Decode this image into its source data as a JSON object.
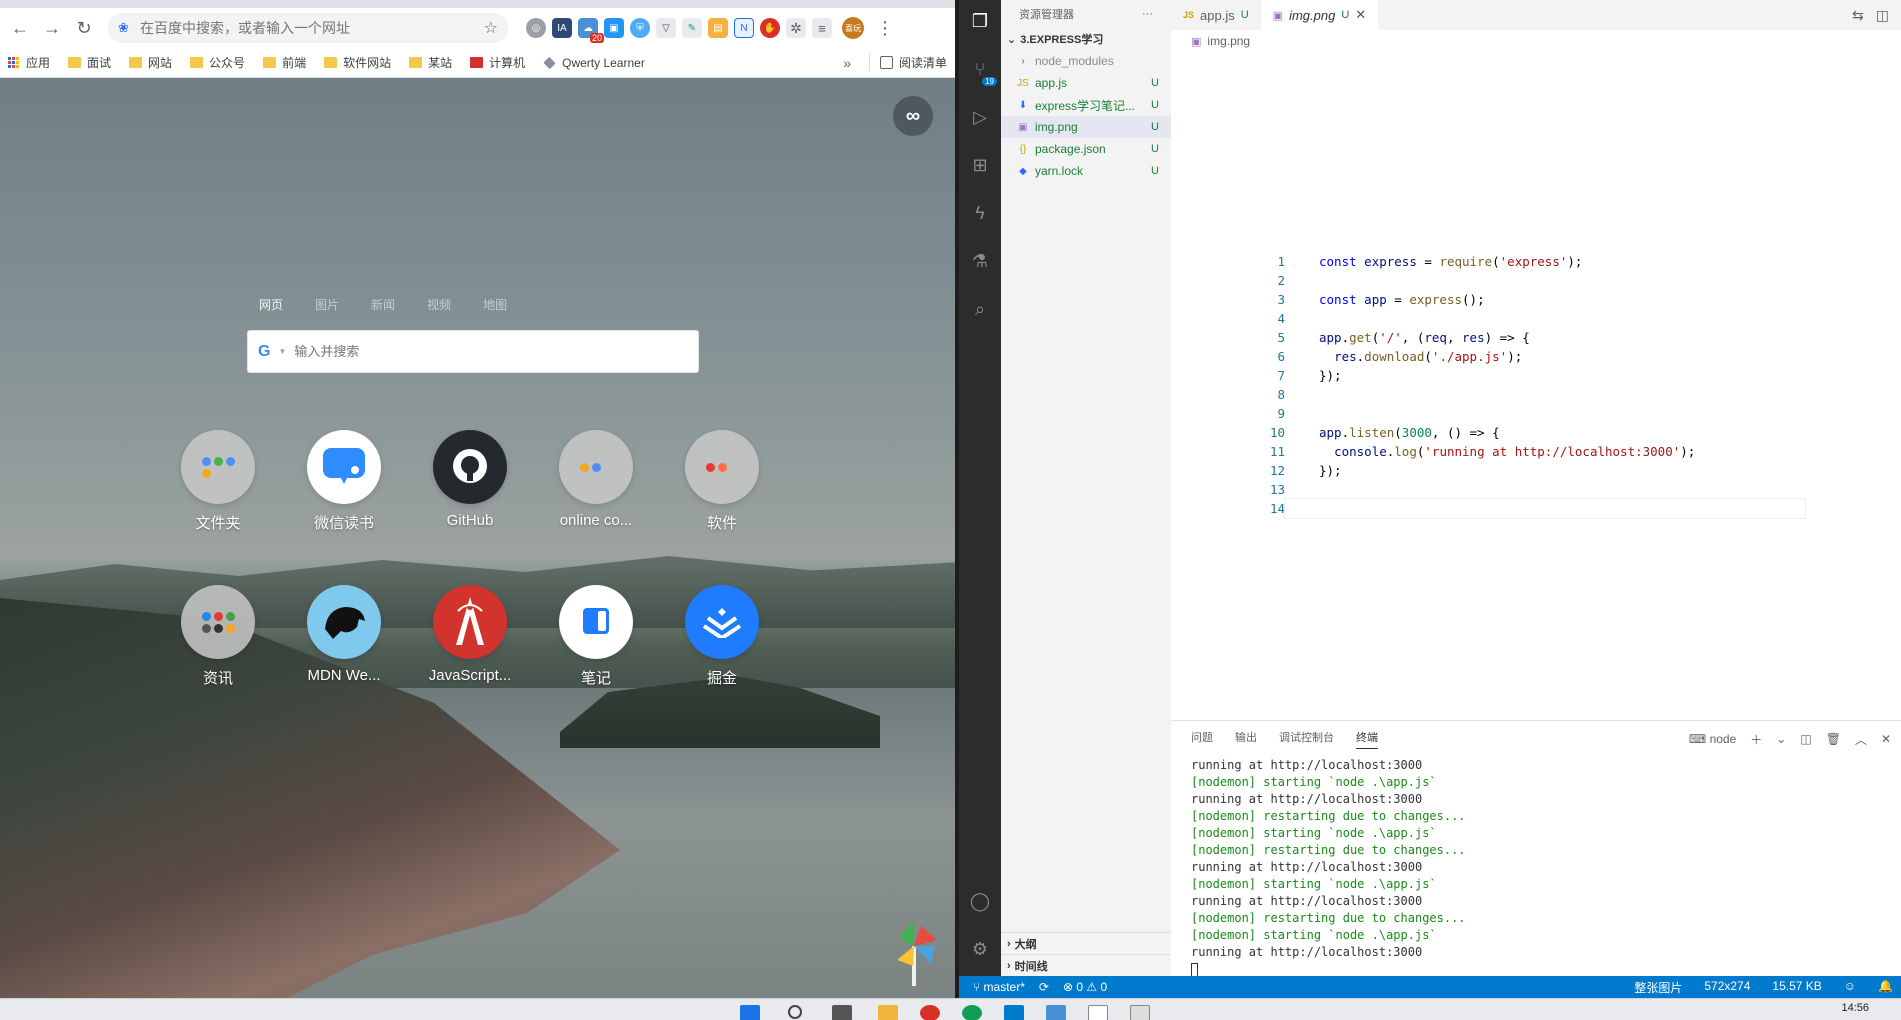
{
  "browser": {
    "omnibox_placeholder": "在百度中搜索，或者输入一个网址",
    "extension_badge": "20",
    "avatar_text": "喜玩",
    "bookmarks": [
      {
        "label": "应用",
        "kind": "apps"
      },
      {
        "label": "面试",
        "kind": "folder"
      },
      {
        "label": "网站",
        "kind": "folder"
      },
      {
        "label": "公众号",
        "kind": "folder"
      },
      {
        "label": "前端",
        "kind": "folder"
      },
      {
        "label": "软件网站",
        "kind": "folder"
      },
      {
        "label": "某站",
        "kind": "folder"
      },
      {
        "label": "计算机",
        "kind": "red"
      },
      {
        "label": "Qwerty Learner",
        "kind": "qwerty"
      }
    ],
    "bookmarks_more": "»",
    "reading_list": "阅读清单",
    "newtab": {
      "search_tabs": [
        "网页",
        "图片",
        "新闻",
        "视频",
        "地图"
      ],
      "search_placeholder": "输入并搜索",
      "tiles_row1": [
        {
          "label": "文件夹",
          "style": "grey",
          "icon": "folder-dots-icon"
        },
        {
          "label": "微信读书",
          "style": "white",
          "icon": "wechat-read-icon"
        },
        {
          "label": "GitHub",
          "style": "dark",
          "icon": "github-icon"
        },
        {
          "label": "online co...",
          "style": "grey",
          "icon": "online-folder-icon"
        },
        {
          "label": "软件",
          "style": "grey",
          "icon": "software-folder-icon"
        }
      ],
      "tiles_row2": [
        {
          "label": "资讯",
          "style": "grey",
          "icon": "news-folder-icon"
        },
        {
          "label": "MDN We...",
          "style": "sky",
          "icon": "mdn-dino-icon"
        },
        {
          "label": "JavaScript...",
          "style": "red",
          "icon": "js-tower-icon"
        },
        {
          "label": "笔记",
          "style": "white",
          "icon": "notes-icon"
        },
        {
          "label": "掘金",
          "style": "blue",
          "icon": "juejin-icon"
        }
      ]
    }
  },
  "vscode": {
    "explorer_title": "资源管理器",
    "explorer_more": "···",
    "folder_name": "3.EXPRESS学习",
    "files": [
      {
        "name": "node_modules",
        "icon": "›",
        "status": "",
        "dim": true,
        "selected": false
      },
      {
        "name": "app.js",
        "icon": "JS",
        "status": "U",
        "dim": false,
        "selected": false
      },
      {
        "name": "express学习笔记...",
        "icon": "⬇",
        "status": "U",
        "dim": false,
        "selected": false
      },
      {
        "name": "img.png",
        "icon": "▣",
        "status": "U",
        "dim": false,
        "selected": true
      },
      {
        "name": "package.json",
        "icon": "{}",
        "status": "U",
        "dim": false,
        "selected": false
      },
      {
        "name": "yarn.lock",
        "icon": "◆",
        "status": "U",
        "dim": false,
        "selected": false
      }
    ],
    "outline_label": "大纲",
    "timeline_label": "时间线",
    "scm_count": "19",
    "tabs": [
      {
        "label": "app.js",
        "status": "U",
        "active": false
      },
      {
        "label": "img.png",
        "status": "U",
        "active": true
      }
    ],
    "breadcrumb": "img.png",
    "code_lines": [
      "const express = require('express');",
      "",
      "const app = express();",
      "",
      "app.get('/', (req, res) => {",
      "  res.download('./app.js');",
      "});",
      "",
      "",
      "app.listen(3000, () => {",
      "  console.log('running at http://localhost:3000');",
      "});",
      "",
      ""
    ],
    "panel_tabs": [
      "问题",
      "输出",
      "调试控制台",
      "终端"
    ],
    "panel_active": "终端",
    "terminal_name": "node",
    "terminal_lines": [
      {
        "text": "running at http://localhost:3000",
        "color": "plain"
      },
      {
        "text": "[nodemon] starting `node .\\app.js`",
        "color": "green"
      },
      {
        "text": "running at http://localhost:3000",
        "color": "plain"
      },
      {
        "text": "[nodemon] restarting due to changes...",
        "color": "green"
      },
      {
        "text": "[nodemon] starting `node .\\app.js`",
        "color": "green"
      },
      {
        "text": "[nodemon] restarting due to changes...",
        "color": "green"
      },
      {
        "text": "running at http://localhost:3000",
        "color": "plain"
      },
      {
        "text": "[nodemon] starting `node .\\app.js`",
        "color": "green"
      },
      {
        "text": "running at http://localhost:3000",
        "color": "plain"
      },
      {
        "text": "[nodemon] restarting due to changes...",
        "color": "green"
      },
      {
        "text": "[nodemon] starting `node .\\app.js`",
        "color": "green"
      },
      {
        "text": "running at http://localhost:3000",
        "color": "plain"
      }
    ],
    "status": {
      "branch": "master*",
      "errors": "0",
      "warnings": "0",
      "image_mode": "整张图片",
      "dimensions": "572x274",
      "size": "15.57 KB"
    }
  },
  "taskbar": {
    "time": "14:56"
  },
  "colors": {
    "statusbar": "#007acc",
    "git_untracked": "#1a7f37",
    "nodemon_green": "#1a8a1a"
  }
}
